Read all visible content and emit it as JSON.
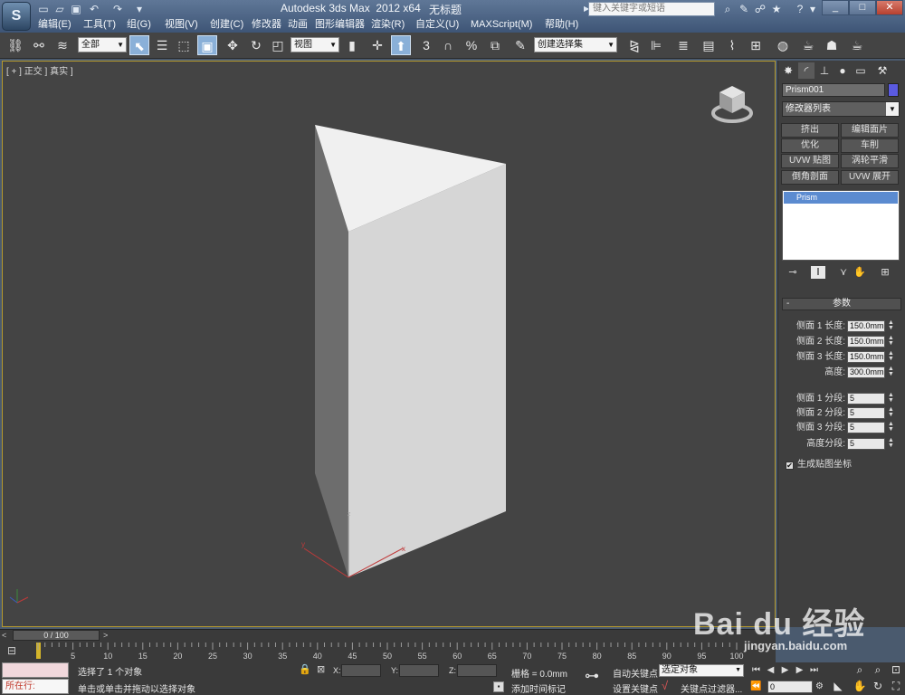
{
  "titlebar": {
    "app_name": "Autodesk 3ds Max  2012 x64",
    "document": "无标题",
    "search_placeholder": "键入关键字或短语",
    "min": "_",
    "max": "□",
    "close": "✕"
  },
  "menu": [
    "编辑(E)",
    "工具(T)",
    "组(G)",
    "视图(V)",
    "创建(C)",
    "修改器",
    "动画",
    "图形编辑器",
    "渲染(R)",
    "自定义(U)",
    "MAXScript(M)",
    "帮助(H)"
  ],
  "toolbar": {
    "selection_filter": "全部",
    "ref_coord": "视图",
    "named_selection": "创建选择集"
  },
  "viewport": {
    "label": "[ + ] 正交 ] 真实 ]"
  },
  "command_panel": {
    "object_name": "Prism001",
    "object_color": "#5a5ae0",
    "modifier_list": "修改器列表",
    "modifier_buttons": [
      "挤出",
      "编辑面片",
      "优化",
      "车削",
      "UVW 贴图",
      "涡轮平滑",
      "倒角剖面",
      "UVW 展开"
    ],
    "stack_item": "Prism",
    "rollout_title": "参数",
    "params": [
      {
        "label": "侧面 1 长度:",
        "value": "150.0mm"
      },
      {
        "label": "侧面 2 长度:",
        "value": "150.0mm"
      },
      {
        "label": "侧面 3 长度:",
        "value": "150.0mm"
      },
      {
        "label": "高度:",
        "value": "300.0mm"
      }
    ],
    "segments": [
      {
        "label": "侧面 1 分段:",
        "value": "5"
      },
      {
        "label": "侧面 2 分段:",
        "value": "5"
      },
      {
        "label": "侧面 3 分段:",
        "value": "5"
      },
      {
        "label": "高度分段:",
        "value": "5"
      }
    ],
    "gen_map": "生成贴图坐标",
    "gen_map_checked": true
  },
  "timeline": {
    "frame_display": "0 / 100",
    "ticks": [
      "5",
      "10",
      "15",
      "20",
      "25",
      "30",
      "35",
      "40",
      "45",
      "50",
      "55",
      "60",
      "65",
      "70",
      "75",
      "80",
      "85",
      "90",
      "95",
      "100"
    ]
  },
  "status": {
    "running": "所在行:",
    "selection": "选择了 1 个对象",
    "prompt": "单击或单击并拖动以选择对象",
    "x_label": "X:",
    "y_label": "Y:",
    "z_label": "Z:",
    "grid": "栅格 = 0.0mm",
    "add_time_tag": "添加时间标记",
    "auto_key": "自动关键点",
    "set_key": "设置关键点",
    "auto_key_mode": "选定对象",
    "key_filters": "关键点过滤器...",
    "current_frame": "0"
  },
  "watermark": {
    "text": "Bai du 经验",
    "url": "jingyan.baidu.com"
  }
}
